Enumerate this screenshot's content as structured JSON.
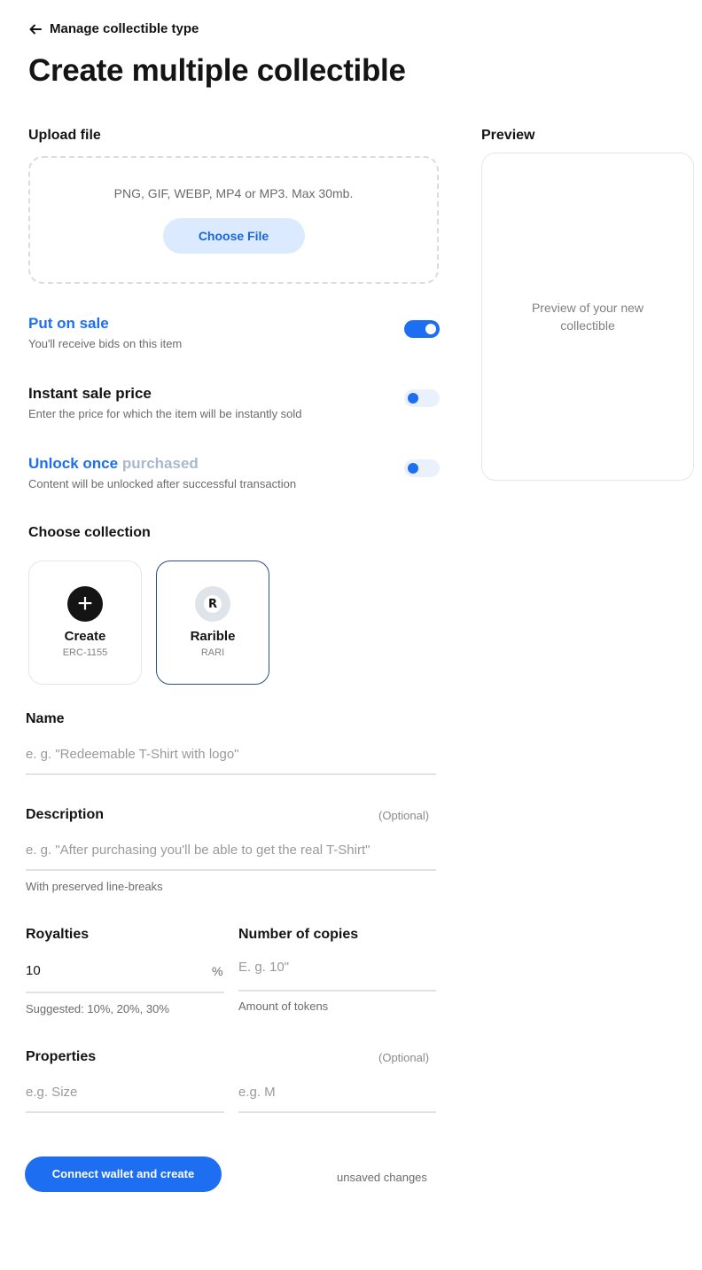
{
  "header": {
    "back_label": "Manage collectible type",
    "title": "Create multiple collectible"
  },
  "upload": {
    "label": "Upload file",
    "hint": "PNG, GIF, WEBP, MP4 or MP3. Max 30mb.",
    "button": "Choose File"
  },
  "preview": {
    "label": "Preview",
    "placeholder": "Preview of your new collectible"
  },
  "toggles": [
    {
      "title": "Put on sale",
      "subtitle": "You'll receive bids on this item",
      "on": true
    },
    {
      "title": "Instant sale price",
      "subtitle": "Enter the price for which the item will be instantly sold",
      "on": false
    },
    {
      "title_a": "Unlock once ",
      "title_b": "purchased",
      "subtitle": "Content will be unlocked after successful transaction",
      "on": false
    }
  ],
  "collection": {
    "label": "Choose collection",
    "cards": [
      {
        "name": "Create",
        "sub": "ERC-1155",
        "icon": "plus-icon"
      },
      {
        "name": "Rarible",
        "sub": "RARI",
        "icon": "rarible-logo",
        "initial": "R"
      }
    ]
  },
  "name_field": {
    "label": "Name",
    "placeholder": "e. g. \"Redeemable T-Shirt with logo\""
  },
  "description_field": {
    "label": "Description",
    "optional": "(Optional)",
    "placeholder": "e. g. \"After purchasing you'll be able to get the real T-Shirt\"",
    "helper": "With preserved line-breaks"
  },
  "royalties": {
    "label": "Royalties",
    "value": "10",
    "unit": "%",
    "helper": "Suggested: 10%, 20%, 30%"
  },
  "copies": {
    "label": "Number of copies",
    "placeholder": "E. g. 10\"",
    "helper": "Amount of tokens"
  },
  "properties": {
    "label": "Properties",
    "optional": "(Optional)",
    "key_placeholder": "e.g. Size",
    "value_placeholder": "e.g. M"
  },
  "footer": {
    "button": "Connect wallet and create",
    "status": "unsaved changes"
  },
  "colors": {
    "accent": "#1e6ef2",
    "accent_light": "#dbeafe"
  }
}
